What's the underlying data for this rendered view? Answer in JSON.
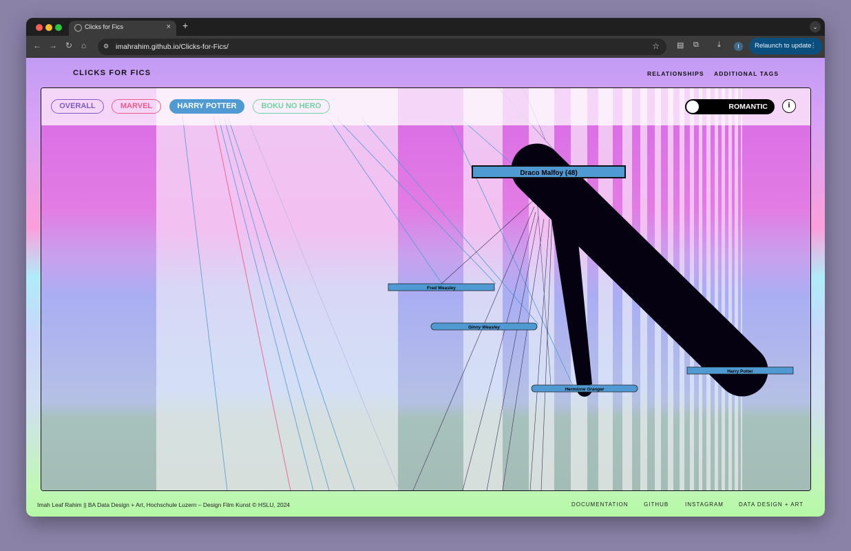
{
  "browser": {
    "tab_title": "Clicks for Fics",
    "tab_close": "×",
    "new_tab": "+",
    "url": "imahrahim.github.io/Clicks-for-Fics/",
    "relaunch_label": "Relaunch to update",
    "profile_initial": "I",
    "icons": [
      "globe-icon",
      "close-icon",
      "plus-icon",
      "chevron-down-icon",
      "back-icon",
      "forward-icon",
      "reload-icon",
      "home-icon",
      "site-settings-icon",
      "star-icon",
      "reading-mode-icon",
      "extensions-icon",
      "download-icon",
      "profile-icon",
      "more-icon"
    ]
  },
  "site": {
    "title": "CLICKS FOR FICS",
    "nav": [
      "RELATIONSHIPS",
      "ADDITIONAL TAGS"
    ]
  },
  "filters": {
    "tabs": [
      {
        "label": "OVERALL",
        "color": "#7c5cc4",
        "active": false
      },
      {
        "label": "MARVEL",
        "color": "#ee5b8a",
        "active": false
      },
      {
        "label": "HARRY POTTER",
        "color": "#4f9ad3",
        "active": true
      },
      {
        "label": "BOKU NO HERO",
        "color": "#6fd0a3",
        "active": false
      }
    ],
    "toggle_label": "ROMANTIC",
    "info_label": "i"
  },
  "network": {
    "nodes": [
      {
        "label": "Draco Malfoy (48)"
      },
      {
        "label": "Fred Weasley"
      },
      {
        "label": "Ginny Weasley"
      },
      {
        "label": "Hermione Granger"
      },
      {
        "label": "Harry Potter"
      }
    ],
    "node_color": "#4f9ad3",
    "edge_color": "#050110"
  },
  "footer": {
    "credit": "Imah Leaf Rahim || BA Data Design + Art, Hochschule Luzern – Design Film Kunst © HSLU, 2024",
    "links": [
      "DOCUMENTATION",
      "GITHUB",
      "INSTAGRAM",
      "DATA DESIGN + ART"
    ]
  }
}
